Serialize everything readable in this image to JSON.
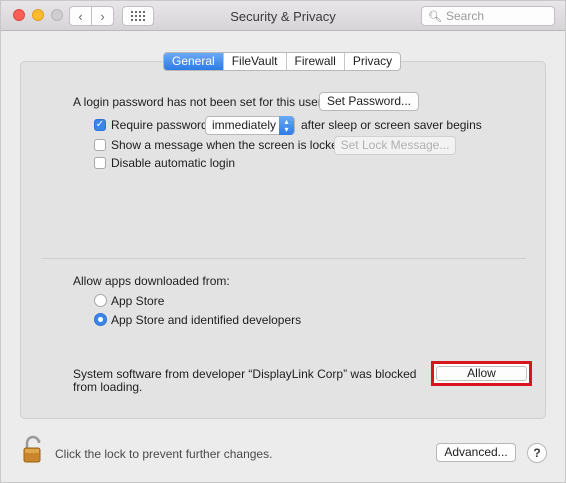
{
  "window": {
    "title": "Security & Privacy",
    "search_placeholder": "Search",
    "nav_back_icon": "chevron-left-icon",
    "nav_forward_icon": "chevron-right-icon",
    "show_all_icon": "grid-icon"
  },
  "tabs": [
    {
      "label": "General",
      "active": true
    },
    {
      "label": "FileVault",
      "active": false
    },
    {
      "label": "Firewall",
      "active": false
    },
    {
      "label": "Privacy",
      "active": false
    }
  ],
  "general": {
    "login_password_text": "A login password has not been set for this user",
    "set_password_button": "Set Password...",
    "require_password": {
      "checked": true,
      "label": "Require password",
      "selected_value": "immediately",
      "suffix": "after sleep or screen saver begins"
    },
    "show_message": {
      "checked": false,
      "label": "Show a message when the screen is locked",
      "button": "Set Lock Message..."
    },
    "disable_auto_login": {
      "checked": false,
      "label": "Disable automatic login"
    }
  },
  "allow_apps": {
    "heading": "Allow apps downloaded from:",
    "options": [
      {
        "label": "App Store",
        "selected": false
      },
      {
        "label": "App Store and identified developers",
        "selected": true
      }
    ]
  },
  "blocked_notice": {
    "text_line1": "System software from developer “DisplayLink Corp” was blocked",
    "text_line2": "from loading.",
    "allow_button": "Allow",
    "highlight_color": "#d8141e"
  },
  "footer": {
    "lock_text": "Click the lock to prevent further changes.",
    "advanced_button": "Advanced...",
    "help_button": "?"
  },
  "colors": {
    "accent": "#3b86ea",
    "close": "#fc5f57",
    "minimize": "#fdbb2e"
  }
}
